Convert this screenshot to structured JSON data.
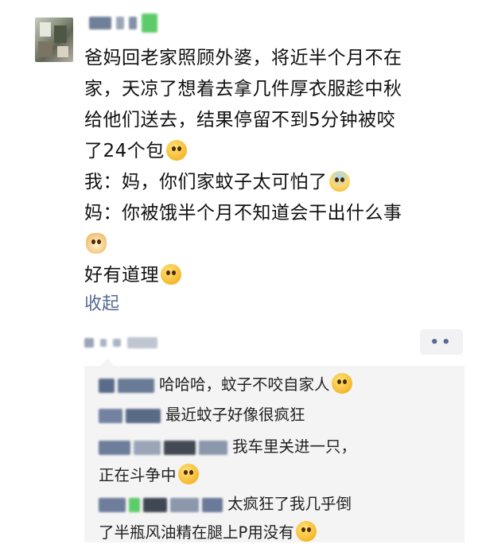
{
  "post": {
    "lines": [
      "爸妈回老家照顾外婆，将近半个月不在",
      "家，天凉了想着去拿几件厚衣服趁中秋",
      "给他们送去，结果停留不到5分钟被咬",
      "了24个包"
    ],
    "line5": "我：妈，你们家蚊子太可怕了",
    "line6": "妈：你被饿半个月不知道会干出什么事",
    "line8": "好有道理",
    "collapse_label": "收起"
  },
  "comments": [
    {
      "text": "哈哈哈，蚊子不咬自家人"
    },
    {
      "text": "最近蚊子好像很疯狂"
    },
    {
      "text_a": "我车里关进一只，",
      "text_b": "正在斗争中"
    },
    {
      "text_a": "太疯狂了我几乎倒",
      "text_b": "了半瓶风油精在腿上P用没有"
    }
  ],
  "colors": {
    "link": "#576b95",
    "comment_bg": "#f4f4f4",
    "more_button_bg": "#f2f2f4"
  },
  "icons": {
    "emoji_1": "grimace-emoji-icon",
    "emoji_2": "scream-emoji-icon",
    "emoji_3": "dog-emoji-icon",
    "emoji_4": "smirk-emoji-icon",
    "more": "more-dots-icon"
  }
}
